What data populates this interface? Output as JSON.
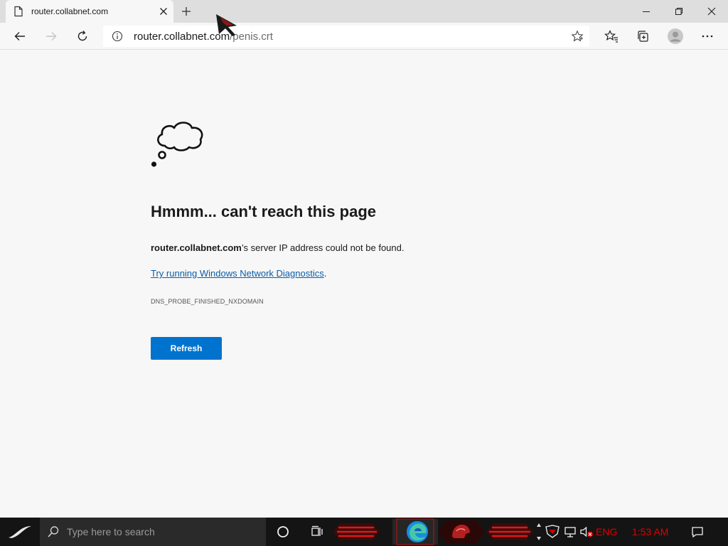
{
  "browser": {
    "tab_title": "router.collabnet.com",
    "url_host": "router.collabnet.com",
    "url_path": "/penis.crt"
  },
  "error": {
    "title": "Hmmm... can't reach this page",
    "host": "router.collabnet.com",
    "message_suffix": "’s server IP address could not be found.",
    "diagnostics_link": "Try running Windows Network Diagnostics",
    "diagnostics_suffix": ".",
    "code": "DNS_PROBE_FINISHED_NXDOMAIN",
    "refresh_label": "Refresh"
  },
  "taskbar": {
    "search_placeholder": "Type here to search",
    "language": "ENG",
    "time": "1:53 AM"
  },
  "colors": {
    "accent": "#0073cf",
    "link": "#0b5da8",
    "tray_text": "#e00000"
  },
  "icons": {
    "tab": "page-icon",
    "error": "thought-cloud-icon",
    "taskbar_browser": "edge-icon"
  }
}
